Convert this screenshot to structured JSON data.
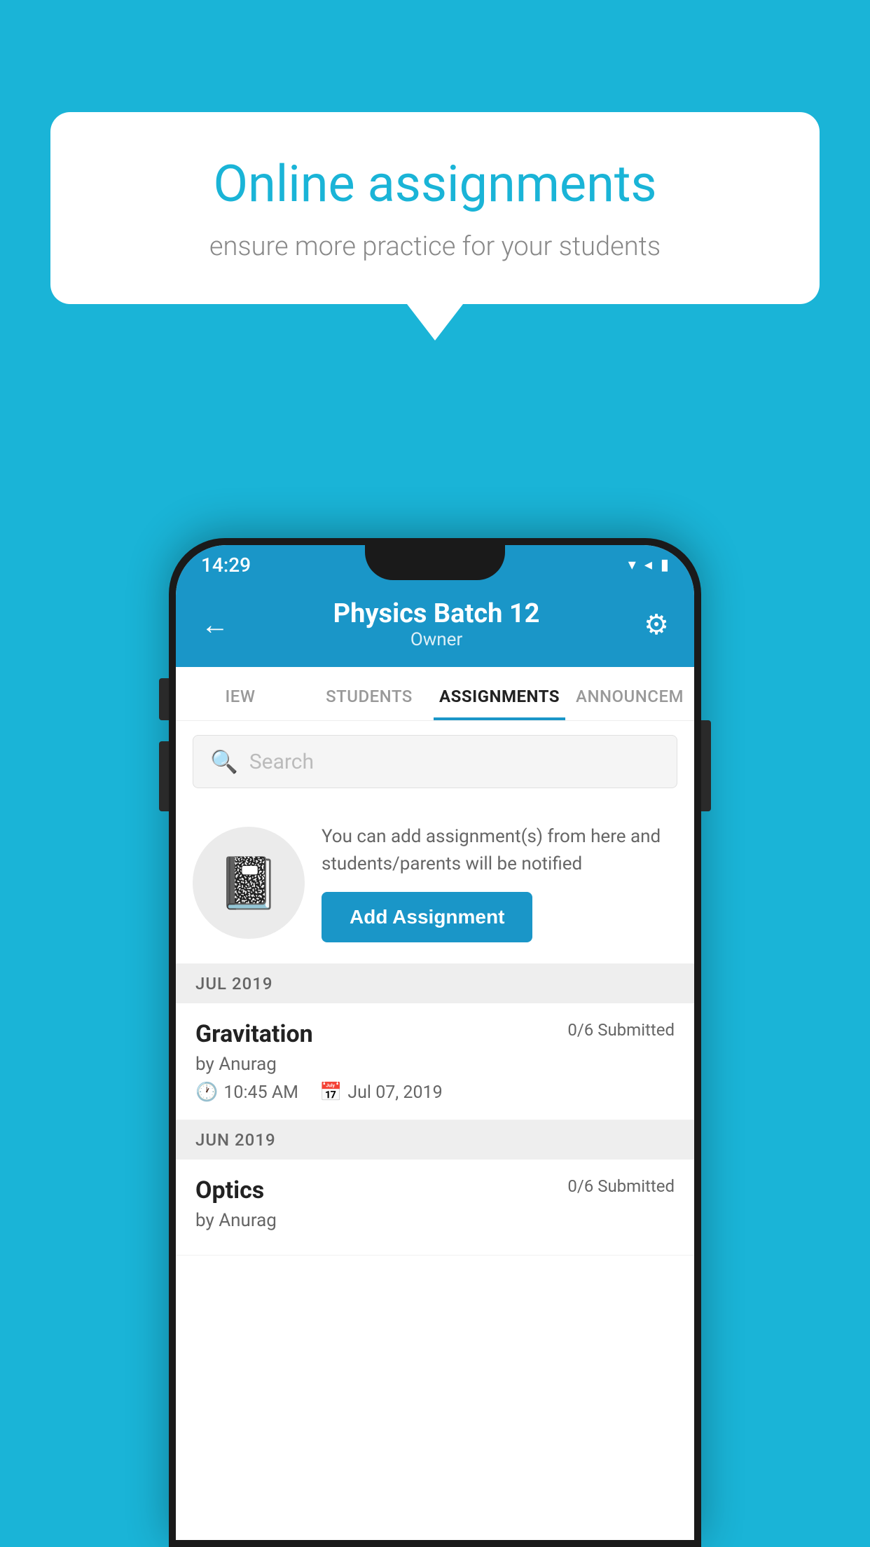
{
  "background": {
    "color": "#1ab4d7"
  },
  "speech_bubble": {
    "title": "Online assignments",
    "subtitle": "ensure more practice for your students"
  },
  "status_bar": {
    "time": "14:29",
    "wifi_icon": "▾",
    "signal_icon": "◂",
    "battery_icon": "▮"
  },
  "header": {
    "title": "Physics Batch 12",
    "subtitle": "Owner",
    "back_label": "←",
    "gear_label": "⚙"
  },
  "tabs": [
    {
      "label": "IEW",
      "active": false
    },
    {
      "label": "STUDENTS",
      "active": false
    },
    {
      "label": "ASSIGNMENTS",
      "active": true
    },
    {
      "label": "ANNOUNCEM",
      "active": false
    }
  ],
  "search": {
    "placeholder": "Search"
  },
  "promo": {
    "text": "You can add assignment(s) from here and students/parents will be notified",
    "button_label": "Add Assignment"
  },
  "sections": [
    {
      "header": "JUL 2019",
      "assignments": [
        {
          "title": "Gravitation",
          "submitted": "0/6 Submitted",
          "by": "by Anurag",
          "time": "10:45 AM",
          "date": "Jul 07, 2019"
        }
      ]
    },
    {
      "header": "JUN 2019",
      "assignments": [
        {
          "title": "Optics",
          "submitted": "0/6 Submitted",
          "by": "by Anurag",
          "time": "",
          "date": ""
        }
      ]
    }
  ]
}
